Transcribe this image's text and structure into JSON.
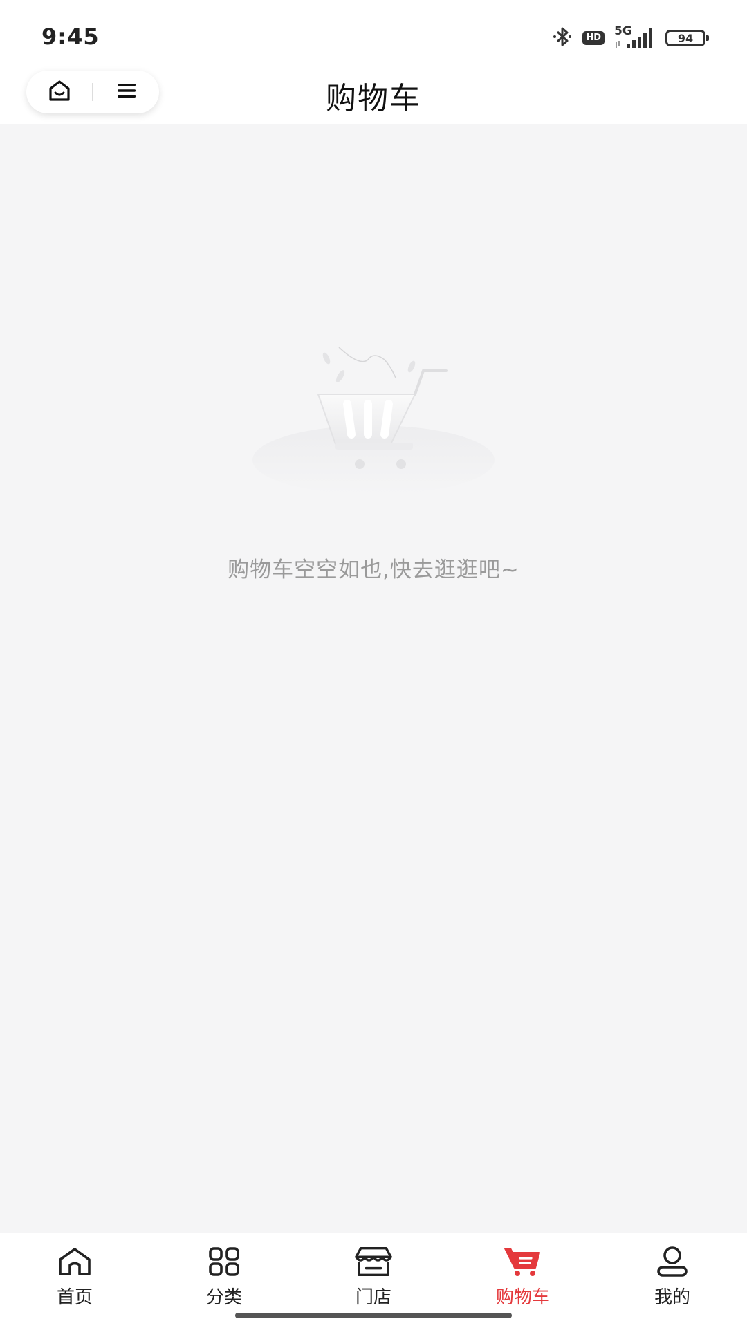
{
  "status_bar": {
    "time": "9:45",
    "bluetooth_icon": "bluetooth-icon",
    "hd_label": "HD",
    "network_label": "5G",
    "battery_level": "94"
  },
  "header": {
    "title": "购物车",
    "capsule": {
      "home_icon": "home-outline-icon",
      "menu_icon": "menu-icon"
    }
  },
  "empty_state": {
    "illustration_icon": "empty-cart-illustration",
    "message": "购物车空空如也,快去逛逛吧~"
  },
  "tab_bar": {
    "active_color": "#e4393c",
    "items": [
      {
        "label": "首页",
        "icon": "home-icon"
      },
      {
        "label": "分类",
        "icon": "category-grid-icon"
      },
      {
        "label": "门店",
        "icon": "store-icon"
      },
      {
        "label": "购物车",
        "icon": "cart-icon",
        "active": true
      },
      {
        "label": "我的",
        "icon": "profile-icon"
      }
    ]
  }
}
